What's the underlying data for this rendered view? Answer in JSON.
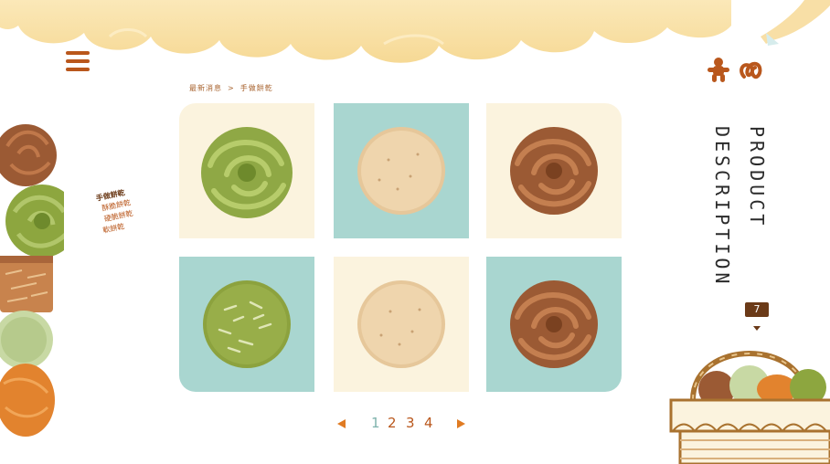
{
  "breadcrumb": {
    "home": "最新消息",
    "separator": ">",
    "current": "手做餅乾"
  },
  "side_nav": {
    "items": [
      {
        "label": "手做餅乾",
        "active": true
      },
      {
        "label": "酥脆餅乾",
        "active": false
      },
      {
        "label": "硬脆餅乾",
        "active": false
      },
      {
        "label": "軟餅乾",
        "active": false
      }
    ]
  },
  "products": [
    {
      "name": "matcha-swirl-cookie",
      "background": "cream"
    },
    {
      "name": "plain-round-cookie",
      "background": "mint"
    },
    {
      "name": "chocolate-swirl-cookie",
      "background": "cream"
    },
    {
      "name": "matcha-almond-cookie",
      "background": "mint"
    },
    {
      "name": "plain-round-cookie",
      "background": "cream"
    },
    {
      "name": "chocolate-swirl-cookie",
      "background": "mint"
    }
  ],
  "pagination": {
    "prev_icon": "triangle-left-icon",
    "next_icon": "triangle-right-icon",
    "pages": [
      "1",
      "2",
      "3",
      "4"
    ],
    "current_page": "1"
  },
  "section_title": {
    "line1": "PRODUCT",
    "line2": "DESCRIPTION"
  },
  "cart": {
    "count": "7"
  },
  "icons": {
    "menu": "hamburger-icon",
    "gingerbread": "gingerbread-man-icon",
    "pretzel": "pretzel-icon",
    "basket": "basket-icon"
  },
  "colors": {
    "accent": "#b9571c",
    "dark_brown": "#6b3a18",
    "cream": "#fbf3de",
    "mint": "#a9d6d0",
    "page_active": "#7fb3ad"
  }
}
